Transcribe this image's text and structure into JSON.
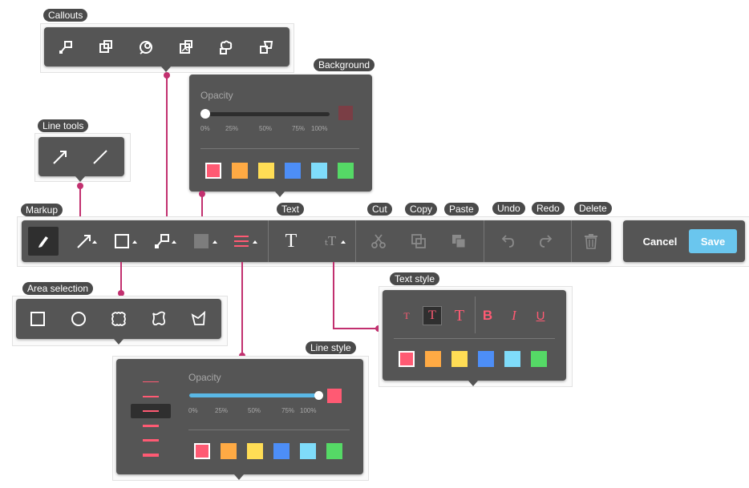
{
  "labels": {
    "callouts": "Callouts",
    "background": "Background",
    "line_tools": "Line tools",
    "markup": "Markup",
    "text": "Text",
    "cut": "Cut",
    "copy": "Copy",
    "paste": "Paste",
    "undo": "Undo",
    "redo": "Redo",
    "delete": "Delete",
    "area_selection": "Area selection",
    "text_style": "Text style",
    "line_style": "Line style"
  },
  "toolbar": {
    "cancel_label": "Cancel",
    "save_label": "Save",
    "text_icon_glyph": "T",
    "text_size_glyph": "ₜT"
  },
  "background_panel": {
    "opacity_label": "Opacity",
    "opacity_value": 0.0,
    "ticks": [
      "0%",
      "25%",
      "50%",
      "75%",
      "100%"
    ],
    "preview_color": "#7a3e45",
    "swatches": [
      "#ff5a73",
      "#ffaa44",
      "#ffdd55",
      "#4d8ef7",
      "#7fdcfa",
      "#55d966"
    ],
    "selected_index": 0
  },
  "line_style_panel": {
    "opacity_label": "Opacity",
    "opacity_value": 1.0,
    "ticks": [
      "0%",
      "25%",
      "50%",
      "75%",
      "100%"
    ],
    "preview_color": "#ff5a73",
    "swatches": [
      "#ff5a73",
      "#ffaa44",
      "#ffdd55",
      "#4d8ef7",
      "#7fdcfa",
      "#55d966"
    ],
    "selected_index": 0,
    "line_widths_count": 6,
    "selected_width_index": 2
  },
  "text_style_panel": {
    "size_glyph": "T",
    "bold_glyph": "B",
    "italic_glyph": "I",
    "underline_glyph": "U",
    "swatches": [
      "#ff5a73",
      "#ffaa44",
      "#ffdd55",
      "#4d8ef7",
      "#7fdcfa",
      "#55d966"
    ],
    "selected_index": 0
  },
  "colors": {
    "accent_pink": "#c2306f",
    "save_blue": "#6ac6ee",
    "panel_bg": "#555555"
  }
}
